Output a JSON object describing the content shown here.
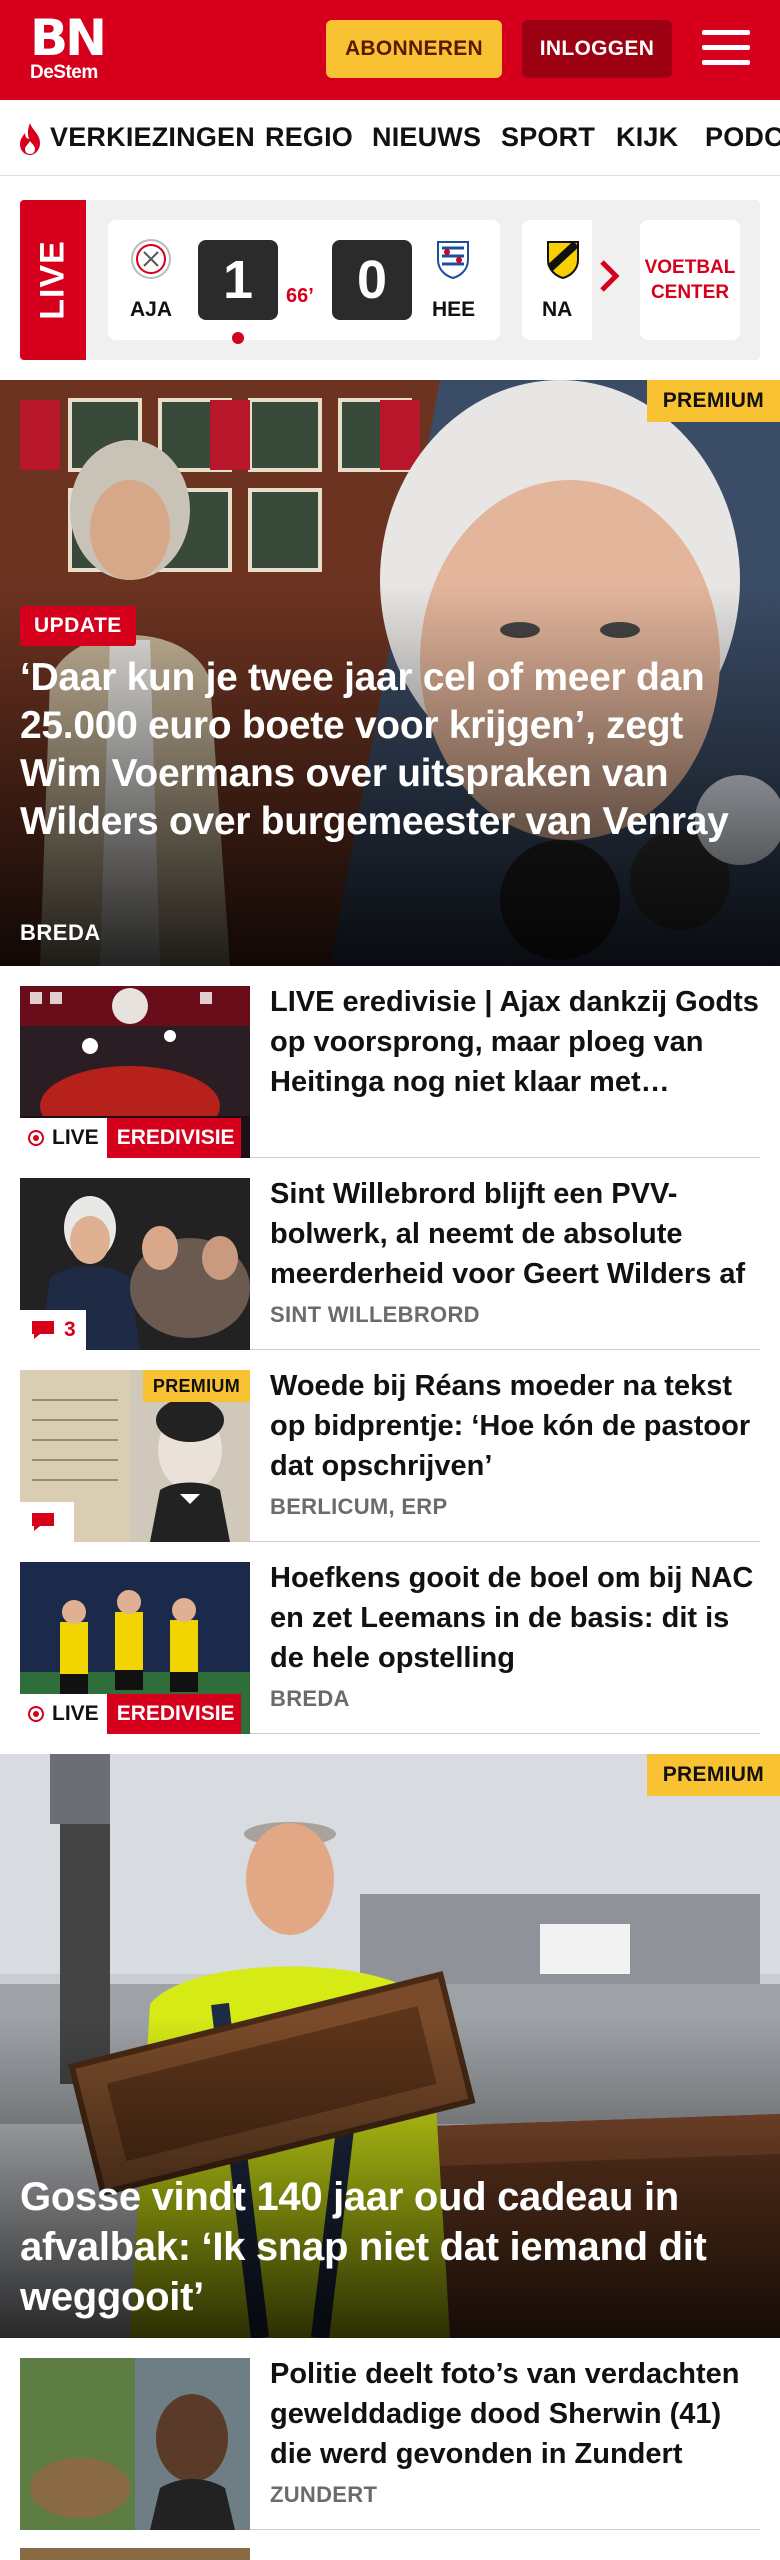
{
  "header": {
    "logo_main": "BN",
    "logo_sub": "DeStem",
    "subscribe_label": "ABONNEREN",
    "login_label": "INLOGGEN",
    "brand_color": "#d6001c"
  },
  "nav": {
    "items": [
      "VERKIEZINGEN",
      "REGIO",
      "NIEUWS",
      "SPORT",
      "KIJK",
      "PODCAST"
    ],
    "first_icon": "flame-icon"
  },
  "live_scores": {
    "tag": "LIVE",
    "match": {
      "home": "AJA",
      "home_score": "1",
      "minute": "66’",
      "away_score": "0",
      "away": "HEE"
    },
    "next_match_team": "NA",
    "voetbal_center_label": "VOETBAL CENTER"
  },
  "hero": {
    "premium": "PREMIUM",
    "badge": "UPDATE",
    "title": "‘Daar kun je twee jaar cel of meer dan 25.000 euro boete voor krijgen’, zegt Wim Voermans over uitspraken van Wilders over burgemeester van Venray",
    "location": "BREDA"
  },
  "articles": [
    {
      "title": "LIVE eredivisie | Ajax dankzij Godts op voorsprong, maar ploeg van Heitinga nog niet klaar met Heerenveen",
      "location": "",
      "tag_live": "LIVE",
      "tag_category": "EREDIVISIE"
    },
    {
      "title": "Sint Willebrord blijft een PVV-bolwerk, al neemt de absolute meerderheid voor Geert Wilders af",
      "location": "SINT WILLEBRORD",
      "comments": "3"
    },
    {
      "title": "Woede bij Réans moeder na tekst op bidprentje: ‘Hoe kón de pastoor dat opschrijven’",
      "location": "BERLICUM, ERP",
      "premium": "PREMIUM",
      "comments": ""
    },
    {
      "title": "Hoefkens gooit de boel om bij NAC en zet Leemans in de basis: dit is de hele opstelling",
      "location": "BREDA",
      "tag_live": "LIVE",
      "tag_category": "EREDIVISIE"
    }
  ],
  "hero2": {
    "premium": "PREMIUM",
    "title": "Gosse vindt 140 jaar oud cadeau in afvalbak: ‘Ik snap niet dat iemand dit weggooit’"
  },
  "articles2": [
    {
      "title": "Politie deelt foto’s van verdachten gewelddadige dood Sherwin (41) die werd gevonden in Zundert",
      "location": "ZUNDERT"
    }
  ]
}
